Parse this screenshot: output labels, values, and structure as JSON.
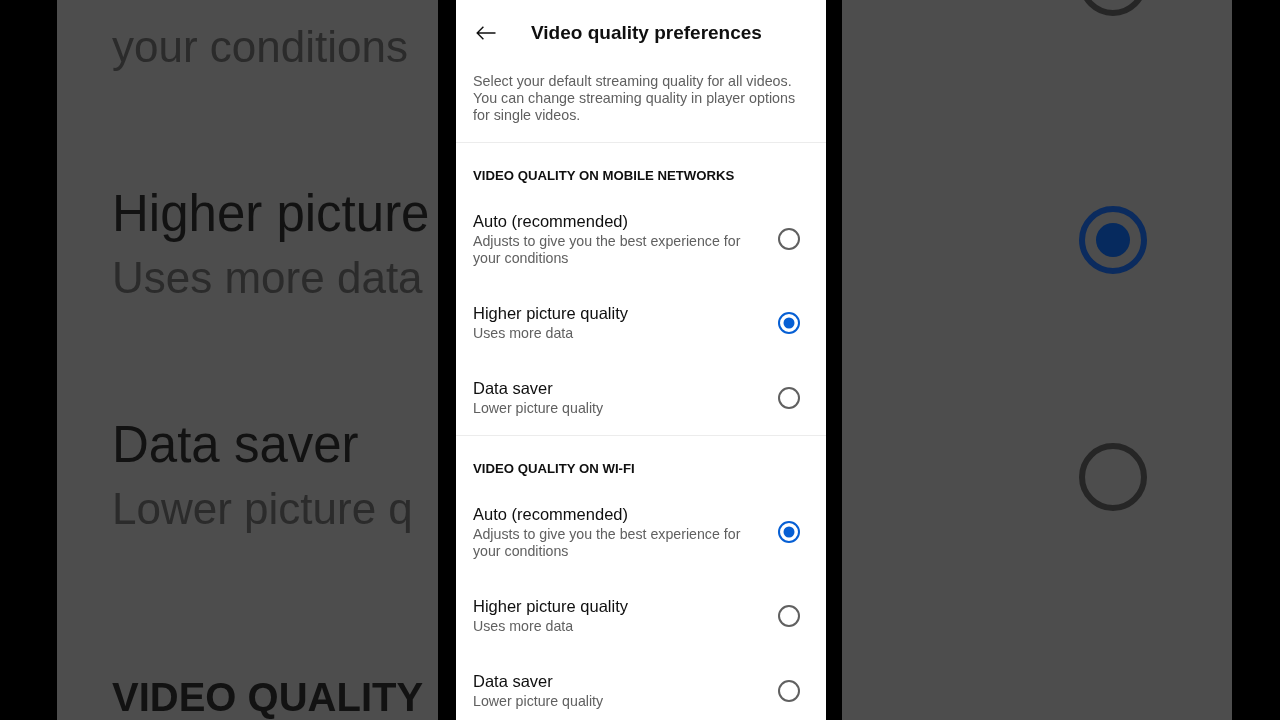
{
  "backdrop": {
    "left": [
      {
        "kind": "subtitle",
        "text": "your conditions"
      },
      {
        "kind": "title",
        "text": "Higher picture"
      },
      {
        "kind": "subtitle",
        "text": "Uses more data"
      },
      {
        "kind": "title",
        "text": "Data saver"
      },
      {
        "kind": "subtitle",
        "text": "Lower picture q"
      },
      {
        "kind": "heading",
        "text": "VIDEO QUALITY"
      }
    ],
    "radios": [
      {
        "selected": false
      },
      {
        "selected": true
      },
      {
        "selected": false
      }
    ]
  },
  "header": {
    "title": "Video quality preferences"
  },
  "description": "Select your default streaming quality for all videos. You can change streaming quality in player options for single videos.",
  "sections": [
    {
      "heading": "VIDEO QUALITY ON MOBILE NETWORKS",
      "options": [
        {
          "title": "Auto (recommended)",
          "subtitle": "Adjusts to give you the best experience for your conditions",
          "selected": false
        },
        {
          "title": "Higher picture quality",
          "subtitle": "Uses more data",
          "selected": true
        },
        {
          "title": "Data saver",
          "subtitle": "Lower picture quality",
          "selected": false
        }
      ]
    },
    {
      "heading": "VIDEO QUALITY ON WI-FI",
      "options": [
        {
          "title": "Auto (recommended)",
          "subtitle": "Adjusts to give you the best experience for your conditions",
          "selected": true
        },
        {
          "title": "Higher picture quality",
          "subtitle": "Uses more data",
          "selected": false
        },
        {
          "title": "Data saver",
          "subtitle": "Lower picture quality",
          "selected": false
        }
      ]
    }
  ]
}
